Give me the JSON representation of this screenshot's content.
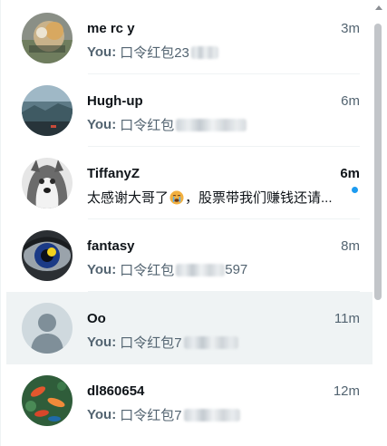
{
  "conversations": [
    {
      "name": "me rc y",
      "time": "3m",
      "you_prefix": "You:",
      "preview": "口令红包23",
      "unread": false,
      "selected": false,
      "avatar_icon": "hamster-photo-avatar"
    },
    {
      "name": "Hugh-up",
      "time": "6m",
      "you_prefix": "You:",
      "preview": "口令红包",
      "unread": false,
      "selected": false,
      "avatar_icon": "landscape-photo-avatar"
    },
    {
      "name": "TiffanyZ",
      "time": "6m",
      "you_prefix": "",
      "preview_before_emoji": "太感谢大哥了",
      "preview_after_emoji": "，股票带我们赚钱还请...",
      "unread": true,
      "selected": false,
      "avatar_icon": "husky-dog-avatar"
    },
    {
      "name": "fantasy",
      "time": "8m",
      "you_prefix": "You:",
      "preview": "口令红包",
      "preview_tail": "597",
      "unread": false,
      "selected": false,
      "avatar_icon": "eye-photo-avatar"
    },
    {
      "name": "Oo",
      "time": "11m",
      "you_prefix": "You:",
      "preview": "口令红包7",
      "unread": false,
      "selected": true,
      "avatar_icon": "default-user-avatar"
    },
    {
      "name": "dl860654",
      "time": "12m",
      "you_prefix": "You:",
      "preview": "口令红包7",
      "unread": false,
      "selected": false,
      "avatar_icon": "koi-fish-avatar"
    }
  ],
  "icons": {
    "emoji": "sob-face-emoji",
    "unread_dot_color": "#1d9bf0"
  },
  "colors": {
    "primary_text": "#0f1419",
    "secondary_text": "#536471",
    "selected_bg": "#eff3f4"
  }
}
